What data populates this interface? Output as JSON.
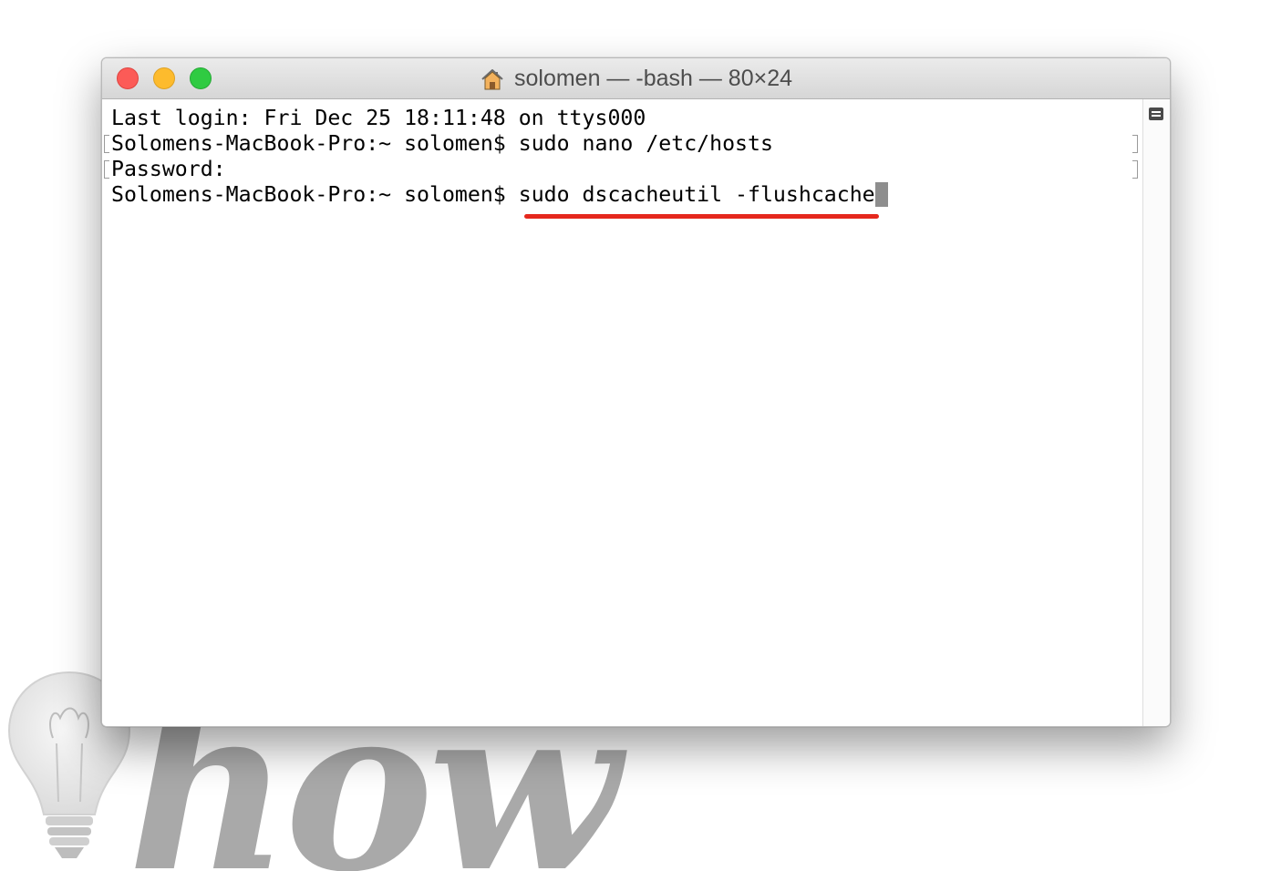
{
  "window": {
    "title": "solomen — -bash — 80×24",
    "title_icon": "home-icon",
    "buttons": {
      "close": "close-button",
      "minimize": "minimize-button",
      "zoom": "zoom-button"
    }
  },
  "terminal": {
    "lines": [
      {
        "prompt": "",
        "text": "Last login: Fri Dec 25 18:11:48 on ttys000"
      },
      {
        "prompt": "Solomens-MacBook-Pro:~ solomen$ ",
        "text": "sudo nano /etc/hosts"
      },
      {
        "prompt": "",
        "text": "Password:"
      },
      {
        "prompt": "Solomens-MacBook-Pro:~ solomen$ ",
        "text": "sudo dscacheutil -flushcache"
      }
    ],
    "highlight_color": "#e5281d",
    "cursor_color": "#8e8e8e"
  },
  "watermark": {
    "text": "how",
    "icon": "lightbulb-icon"
  },
  "colors": {
    "close": "#fc5b57",
    "minimize": "#fdbb2d",
    "zoom": "#2fcb42"
  }
}
